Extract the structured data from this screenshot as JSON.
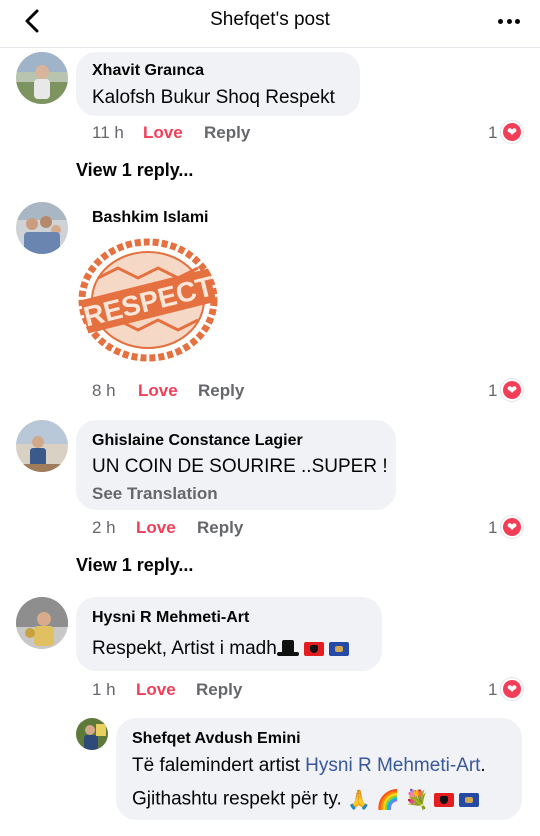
{
  "header": {
    "title": "Shefqet's post"
  },
  "comments": [
    {
      "name": "Xhavit Graınca",
      "text": "Kalofsh Bukur Shoq Respekt",
      "time": "11 h",
      "love": "Love",
      "reply": "Reply",
      "reactions": "1"
    },
    {
      "name": "Bashkim Islami",
      "sticker_text": "RESPECT",
      "time": "8 h",
      "love": "Love",
      "reply": "Reply",
      "reactions": "1"
    },
    {
      "name": "Ghislaine Constance Lagier",
      "text": "UN COIN DE SOURIRE ..SUPER !",
      "see_translation": "See Translation",
      "time": "2 h",
      "love": "Love",
      "reply": "Reply",
      "reactions": "1"
    },
    {
      "name": "Hysni R Mehmeti-Art",
      "text": "Respekt, Artist i madh",
      "time": "1 h",
      "love": "Love",
      "reply": "Reply",
      "reactions": "1"
    }
  ],
  "view_replies": "View 1 reply...",
  "reply": {
    "name": "Shefqet Avdush Emini",
    "text_before": "Të falemindert artist ",
    "mention": "Hysni R Mehmeti-Art",
    "text_after": ".",
    "line2": "Gjithashtu respekt për ty."
  },
  "colors": {
    "love": "#f33e58",
    "bubble": "#f0f2f5",
    "link": "#385898",
    "muted": "#65676b"
  },
  "icons": [
    "back-arrow-icon",
    "more-icon",
    "heart-reaction-icon",
    "tophat-emoji",
    "albania-flag",
    "kosovo-flag",
    "pray-emoji",
    "rainbow-emoji",
    "bouquet-emoji"
  ]
}
